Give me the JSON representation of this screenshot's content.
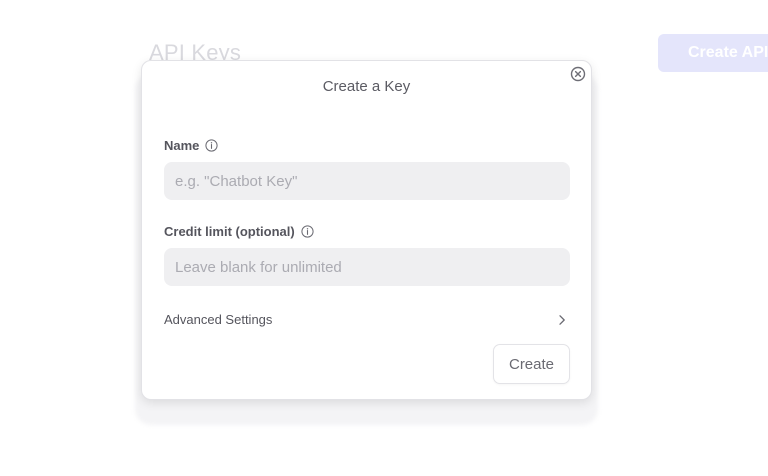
{
  "background": {
    "page_title": "API Keys",
    "create_button_label": "Create API"
  },
  "dialog": {
    "title": "Create a Key",
    "close_icon": "close-circle-icon",
    "name_field": {
      "label": "Name",
      "info_icon": "info-icon",
      "placeholder": "e.g. \"Chatbot Key\"",
      "value": ""
    },
    "credit_field": {
      "label": "Credit limit (optional)",
      "info_icon": "info-icon",
      "placeholder": "Leave blank for unlimited",
      "value": ""
    },
    "advanced": {
      "label": "Advanced Settings",
      "icon": "chevron-right-icon"
    },
    "create_button_label": "Create"
  },
  "colors": {
    "accent_faded": "#e4e5fb",
    "input_bg": "#efeff1",
    "label_text": "#55555d"
  }
}
